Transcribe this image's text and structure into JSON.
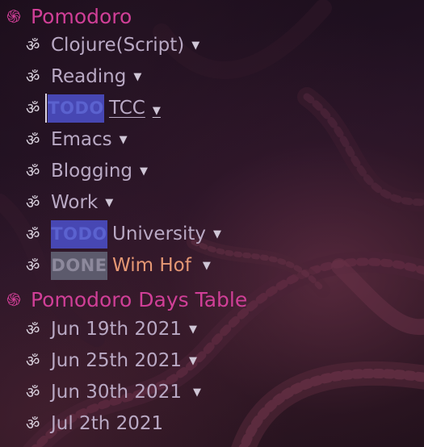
{
  "colors": {
    "heading": "#d03f97",
    "item_text": "#b9a9c4",
    "todo_bg": "#4747b3",
    "done_bg": "#5c5a6c",
    "done_title": "#e59774"
  },
  "icons": {
    "heading_bullet": "spiral-icon",
    "item_bullet": "om-icon",
    "fold_indicator": "chevron-down-icon"
  },
  "outline": {
    "pomodoro": {
      "bullet": "֍",
      "title": "Pomodoro",
      "items": [
        {
          "bullet": "ॐ",
          "title": "Clojure(Script)",
          "caret": "▼"
        },
        {
          "bullet": "ॐ",
          "title": "Reading",
          "caret": "▼"
        },
        {
          "bullet": "ॐ",
          "keyword": "TODO",
          "title": "TCC",
          "caret": "▼"
        },
        {
          "bullet": "ॐ",
          "title": "Emacs",
          "caret": "▼"
        },
        {
          "bullet": "ॐ",
          "title": "Blogging",
          "caret": "▼"
        },
        {
          "bullet": "ॐ",
          "title": "Work",
          "caret": "▼"
        },
        {
          "bullet": "ॐ",
          "keyword": "TODO",
          "title": "University",
          "caret": "▼"
        },
        {
          "bullet": "ॐ",
          "keyword": "DONE",
          "title": "Wim Hof",
          "caret": "▼"
        }
      ]
    },
    "days_table": {
      "bullet": "֍",
      "title": "Pomodoro Days Table",
      "items": [
        {
          "bullet": "ॐ",
          "title": "Jun 19th 2021",
          "caret": "▼"
        },
        {
          "bullet": "ॐ",
          "title": "Jun 25th 2021",
          "caret": "▼"
        },
        {
          "bullet": "ॐ",
          "title": "Jun 30th 2021",
          "caret": "▼"
        },
        {
          "bullet": "ॐ",
          "title": "Jul 2th 2021"
        }
      ]
    }
  }
}
